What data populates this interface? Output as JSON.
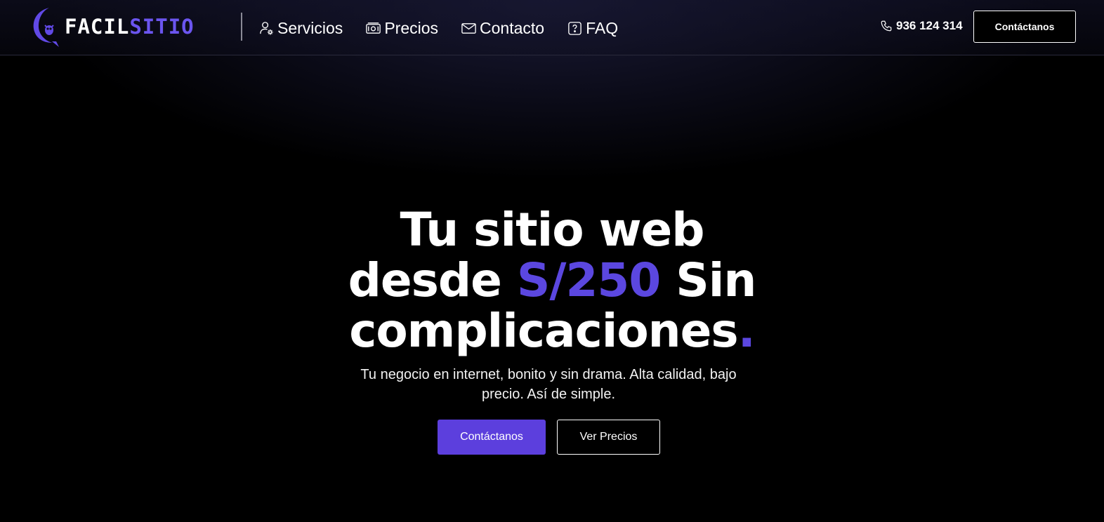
{
  "brand": {
    "name_part1": "FACIL",
    "name_part2": "SITIO",
    "accent_color": "#5b47e0"
  },
  "nav": {
    "items": [
      {
        "label": "Servicios",
        "icon": "user-gear-icon"
      },
      {
        "label": "Precios",
        "icon": "money-bill-icon"
      },
      {
        "label": "Contacto",
        "icon": "envelope-icon"
      },
      {
        "label": "FAQ",
        "icon": "question-square-icon"
      }
    ]
  },
  "header": {
    "phone": "936 124 314",
    "phone_icon": "phone-icon",
    "cta_label": "Contáctanos"
  },
  "hero": {
    "title_line1": "Tu sitio web",
    "title_line2_a": "desde ",
    "title_price": "S/250",
    "title_line2_b": " Sin",
    "title_line3": "complicaciones",
    "title_dot": ".",
    "subtitle": "Tu negocio en internet, bonito y sin drama. Alta calidad, bajo precio. Así de simple.",
    "primary_button": "Contáctanos",
    "secondary_button": "Ver Precios"
  },
  "colors": {
    "primary_button": "#5c3fdd",
    "background": "#000000"
  }
}
